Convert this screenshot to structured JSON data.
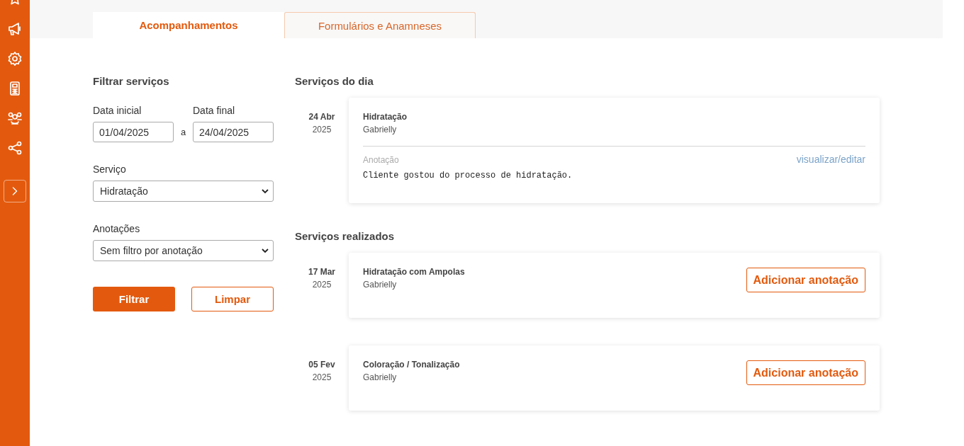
{
  "tabs": [
    {
      "label": "Acompanhamentos",
      "selected": true
    },
    {
      "label": "Formulários e Anamneses",
      "selected": false
    }
  ],
  "filter": {
    "title": "Filtrar serviços",
    "start_label": "Data inicial",
    "start_value": "01/04/2025",
    "separator": "a",
    "end_label": "Data final",
    "end_value": "24/04/2025",
    "service_label": "Serviço",
    "service_value": "Hidratação",
    "notes_label": "Anotações",
    "notes_value": "Sem filtro por anotação",
    "buttons": [
      {
        "label": "Filtrar",
        "kind": "primary"
      },
      {
        "label": "Limpar",
        "kind": "outline"
      }
    ]
  },
  "sections": [
    {
      "title": "Serviços do dia",
      "items": [
        {
          "day": "24 Abr",
          "year": "2025",
          "service": "Hidratação",
          "professional": "Gabrielly",
          "note_label": "Anotação",
          "note_link": "visualizar/editar",
          "note": "Cliente gostou do processo de hidratação."
        }
      ]
    },
    {
      "title": "Serviços realizados",
      "items": [
        {
          "day": "17 Mar",
          "year": "2025",
          "service": "Hidratação com Ampolas",
          "professional": "Gabrielly",
          "action": "Adicionar anotação"
        },
        {
          "day": "05 Fev",
          "year": "2025",
          "service": "Coloração / Tonalização",
          "professional": "Gabrielly",
          "action": "Adicionar anotação"
        }
      ]
    }
  ]
}
